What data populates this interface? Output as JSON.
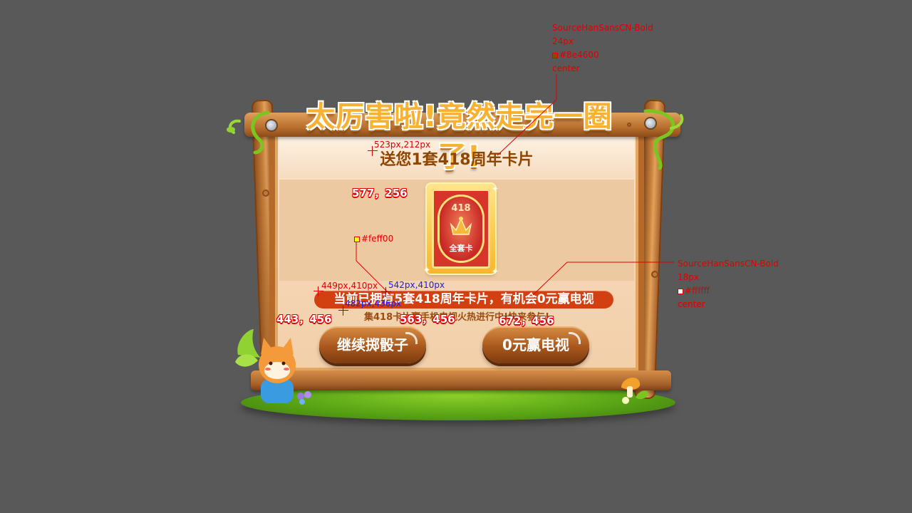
{
  "dialog": {
    "header_title": "太厉害啦!竟然走完一圈了!",
    "subtitle": "送您1套418周年卡片",
    "card": {
      "number": "418",
      "label": "全套卡",
      "icon": "crown-icon"
    },
    "highlight_text": "当前已拥有5套418周年卡片，有机会0元赢电视",
    "description": "集418卡片赢手机电视火热进行中!快来参与!",
    "buttons": {
      "continue_label": "继续掷骰子",
      "win_tv_label": "0元赢电视"
    }
  },
  "annotations": {
    "font_spec_top": [
      "SourceHanSansCN-Bold",
      "24px",
      "#8e4600",
      "center"
    ],
    "font_spec_right": [
      "SourceHanSansCN-Bold",
      "18px",
      "#ffffff",
      "center"
    ],
    "color_label": "#feff00",
    "coord_subtitle": "523px,212px",
    "coord_card": "577，256",
    "coord_pill_left": "449px,410px",
    "coord_pill_mid": "542px,410px",
    "coord_desc": "482px,436px",
    "coord_btn1": "443，456",
    "coord_btn2": "563，456",
    "coord_btn3": "672，456"
  },
  "colors": {
    "background": "#595959",
    "title_text": "#8e4600",
    "pill_bg": "#d24012",
    "pill_text": "#ffffff",
    "highlight_number": "#feff00",
    "button_brown": "#a9581d",
    "annotation_red": "#e00000",
    "annotation_blue": "#1a1aff"
  }
}
